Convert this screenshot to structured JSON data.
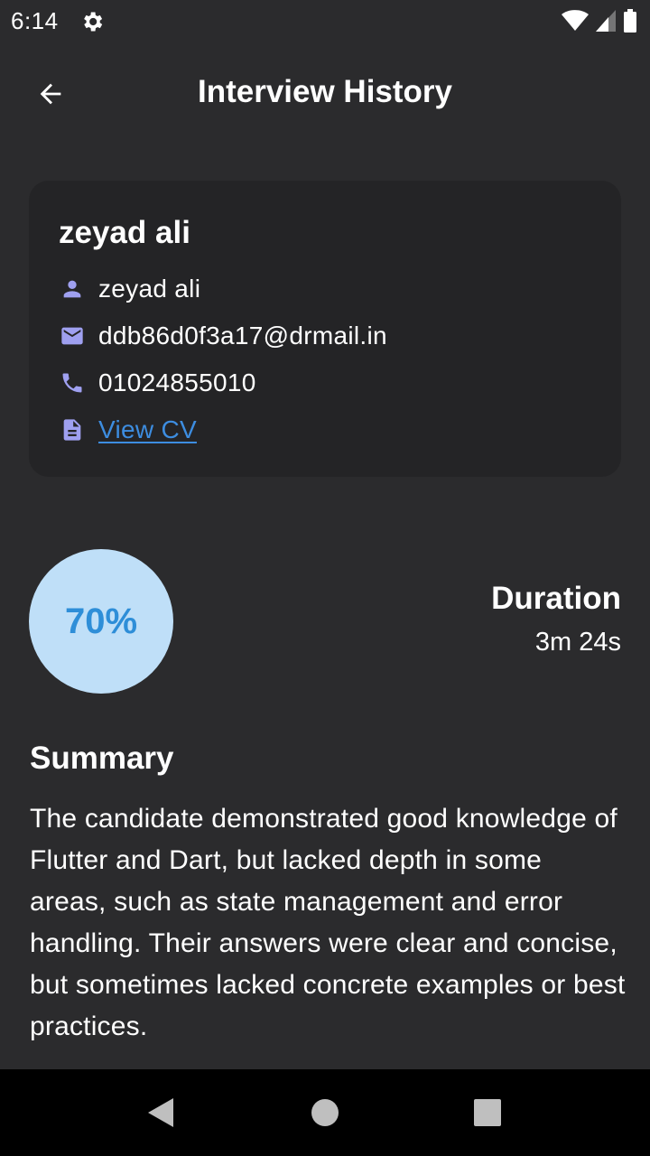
{
  "status_bar": {
    "time": "6:14",
    "icons": [
      "gear-icon",
      "wifi-icon",
      "cellular-signal-icon",
      "battery-icon"
    ]
  },
  "app_bar": {
    "title": "Interview History",
    "back_icon": "arrow-back-icon"
  },
  "candidate": {
    "name_heading": "zeyad ali",
    "name": "zeyad ali",
    "email": "ddb86d0f3a17@drmail.in",
    "phone": "01024855010",
    "cv_link_label": "View CV",
    "icons": [
      "person-icon",
      "mail-icon",
      "phone-icon",
      "document-icon"
    ]
  },
  "result": {
    "score": "70%",
    "score_fraction": 0.7,
    "duration_label": "Duration",
    "duration_value": "3m 24s"
  },
  "summary": {
    "title": "Summary",
    "text": "The candidate demonstrated good knowledge of Flutter and Dart, but lacked depth in some areas, such as state management and error handling. Their answers were clear and concise, but sometimes lacked concrete examples or best practices."
  },
  "colors": {
    "background": "#2b2b2d",
    "card": "#242426",
    "icon_accent": "#9fa0f0",
    "link": "#3d8de0",
    "score_fill": "#bfdff8",
    "score_text": "#2e8ed8"
  },
  "nav_bar": {
    "icons": [
      "back-triangle-icon",
      "home-circle-icon",
      "recents-square-icon"
    ]
  }
}
